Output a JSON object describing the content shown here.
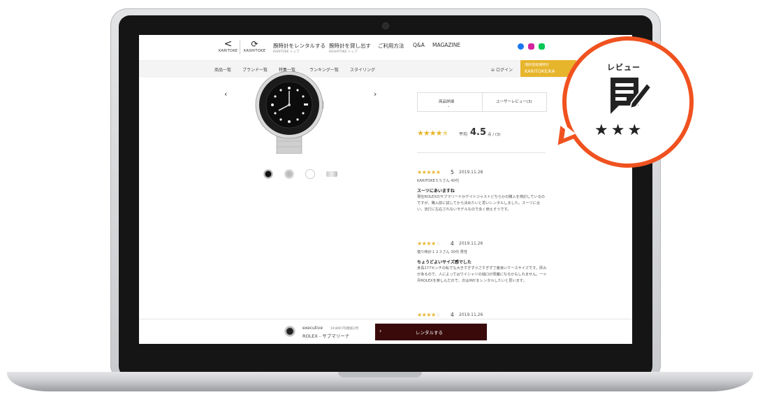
{
  "header": {
    "logo_left": "KARITOKE",
    "logo_right": "KASHITOKE",
    "link1_main": "腕時計をレンタルする",
    "link1_sub": "KARITOKE トップ",
    "link2_main": "腕時計を貸し出す",
    "link2_sub": "KASHITOKE トップ",
    "links": [
      "ご利用方法",
      "Q&A",
      "MAGAZINE"
    ]
  },
  "social_icons": [
    "facebook-icon",
    "instagram-icon",
    "line-icon"
  ],
  "nav": {
    "items": [
      "商品一覧",
      "ブランド一覧",
      "特集一覧",
      "ランキング一覧",
      "スタイリング"
    ],
    "login": "ログイン",
    "cta_line1": "[無料登録]腕時計",
    "cta_line2": "KARITOKE/KA"
  },
  "product": {
    "prev": "‹",
    "next": "›"
  },
  "tabs": {
    "detail": "商品詳細",
    "reviews": "ユーザーレビュー(3)"
  },
  "rating": {
    "stars": 4.5,
    "label": "平均",
    "value": "4.5",
    "unit": "点 / (3)"
  },
  "reviews": [
    {
      "stars": 5,
      "score": "5",
      "date": "2019.11.28",
      "author": "KARITOKE５５さん 40代",
      "title": "スーツにあいますね",
      "body": "現在ROLEXのサブマリーナかデイトジャストどちらかの購入を検討しているのですが、購入前に試してから決めたいと思いレンタルしました。スーツに合い、流行に左右されないモデルなので永く使えそうです。"
    },
    {
      "stars": 4,
      "score": "4",
      "date": "2019.11.26",
      "author": "借り時計１２３さん 30代 男性",
      "title": "ちょうどよいサイズ感でした",
      "body": "身長177センチの私でも大きすぎず小さすぎず丁度良いケースサイズです。厚みがあるので、人によってはワイシャツの袖口が邪魔になるかもしれません。一ヶ月ROLEXを楽しんだので、次はIWCをレンタルしたいと思います。"
    },
    {
      "stars": 4,
      "score": "4",
      "date": "2019.11.26"
    }
  ],
  "footer": {
    "brand": "executive",
    "price": "19,800 円(税抜)/月",
    "model": "ROLEX - サブマリーナ",
    "rent_label": "レンタルする",
    "rent_chevron": "›"
  },
  "callout": {
    "title": "レビュー",
    "stars": "★★★"
  },
  "colors": {
    "star": "#e7b52c",
    "cta": "#e7b52c",
    "rent_button": "#3a0a0a",
    "callout_ring": "#f0521f"
  }
}
